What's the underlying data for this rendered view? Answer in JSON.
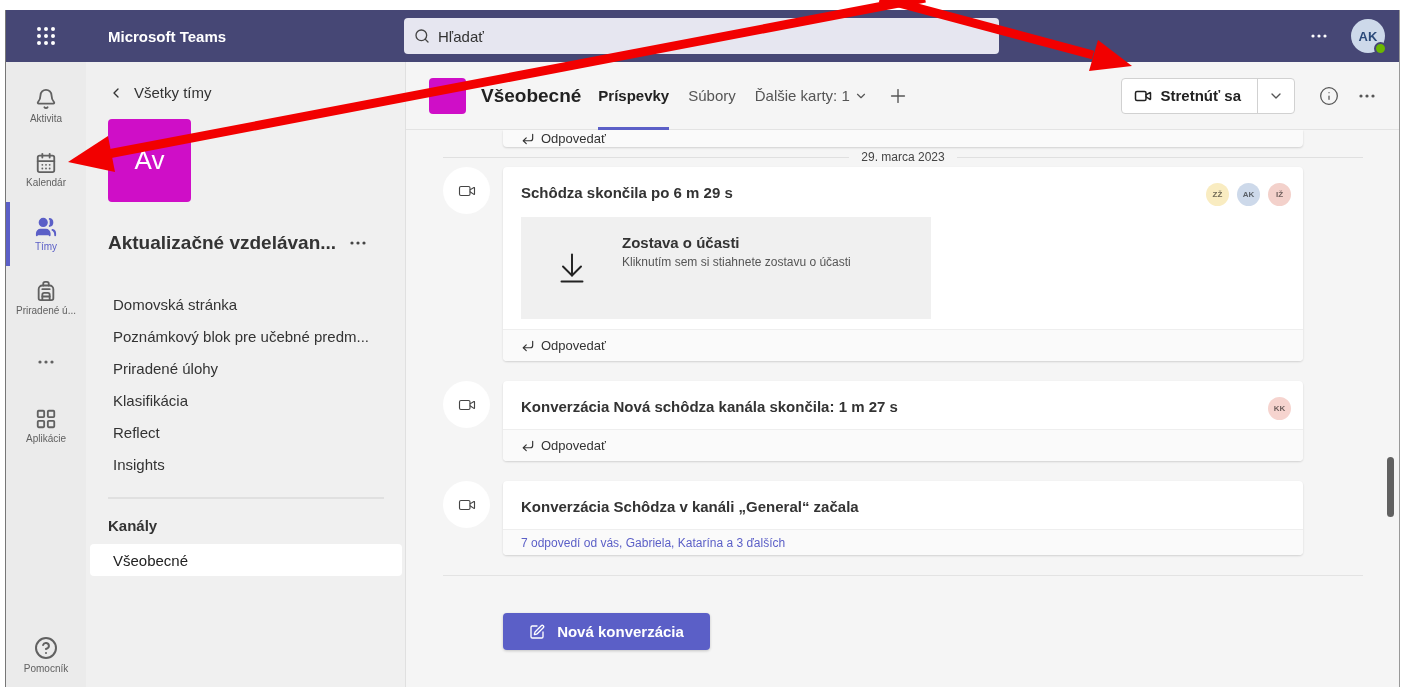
{
  "app": {
    "title": "Microsoft Teams"
  },
  "search": {
    "placeholder": "Hľadať"
  },
  "user": {
    "initials": "AK"
  },
  "rail": [
    {
      "label": "Aktivita",
      "kind": "bell",
      "selected": false
    },
    {
      "label": "Kalendár",
      "kind": "calendar",
      "selected": false
    },
    {
      "label": "Tímy",
      "kind": "teams",
      "selected": true
    },
    {
      "label": "Priradené ú...",
      "kind": "backpack",
      "selected": false
    },
    {
      "kind": "more",
      "selected": false
    },
    {
      "label": "Aplikácie",
      "kind": "apps",
      "selected": false
    }
  ],
  "rail_bottom": {
    "label": "Pomocník"
  },
  "team_panel": {
    "back": "Všetky tímy",
    "tile": "Av",
    "name": "Aktualizačné vzdelávan...",
    "items": [
      "Domovská stránka",
      "Poznámkový blok pre učebné predm...",
      "Priradené úlohy",
      "Klasifikácia",
      "Reflect",
      "Insights"
    ],
    "channels_heading": "Kanály",
    "channels": [
      {
        "name": "Všeobecné",
        "selected": true
      }
    ]
  },
  "channel": {
    "name": "Všeobecné",
    "tabs": [
      {
        "label": "Príspevky",
        "selected": true,
        "kind": "tab"
      },
      {
        "label": "Súbory",
        "selected": false,
        "kind": "tab"
      },
      {
        "label": "Ďalšie karty: 1",
        "selected": false,
        "kind": "dropdown"
      }
    ],
    "meet_button": "Stretnúť sa"
  },
  "feed": {
    "partial_reply": "Odpovedať",
    "date": "29. marca 2023",
    "posts": [
      {
        "title": "Schôdza skončila po 6 m 29 s",
        "avatars": [
          {
            "initials": "ZŽ",
            "color": "#f9ecc1"
          },
          {
            "initials": "AK",
            "color": "#cdd9ea"
          },
          {
            "initials": "IŽ",
            "color": "#f3d1cb"
          }
        ],
        "attachment": {
          "title": "Zostava o účasti",
          "subtitle": "Kliknutím sem si stiahnete zostavu o účasti"
        },
        "footer": {
          "kind": "reply",
          "text": "Odpovedať"
        }
      },
      {
        "title": "Konverzácia Nová schôdza kanála skončila: 1 m 27 s",
        "avatars": [
          {
            "initials": "KK",
            "color": "#f6d4cf"
          }
        ],
        "footer": {
          "kind": "reply",
          "text": "Odpovedať"
        }
      },
      {
        "title": "Konverzácia Schôdza v kanáli „General“ začala",
        "footer": {
          "kind": "replies",
          "text": "7 odpovedí od vás, Gabriela, Katarína a 3 ďalších"
        }
      }
    ],
    "new_post_button": "Nová konverzácia"
  }
}
